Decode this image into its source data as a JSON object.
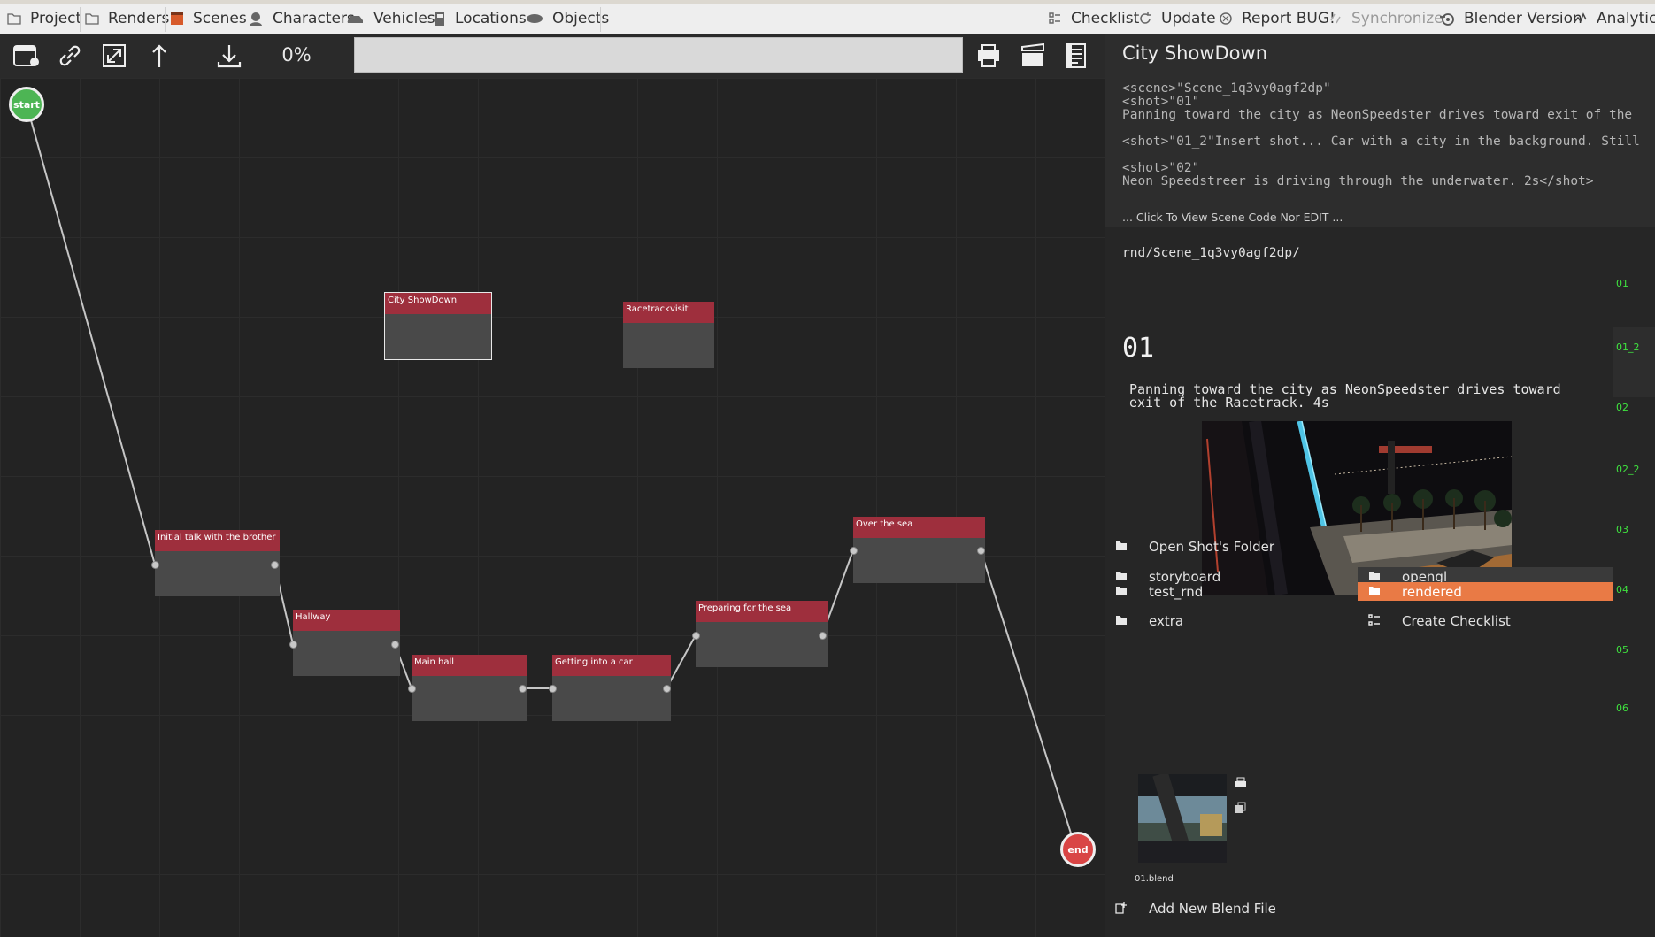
{
  "topbar": {
    "left_items": [
      {
        "label": "Project",
        "icon": "folder-icon"
      },
      {
        "label": "Renders",
        "icon": "folder-icon"
      },
      {
        "label": "Scenes",
        "icon": "clapper-icon"
      },
      {
        "label": "Characters",
        "icon": "character-icon"
      },
      {
        "label": "Vehicles",
        "icon": "vehicle-icon"
      },
      {
        "label": "Locations",
        "icon": "location-icon"
      },
      {
        "label": "Objects",
        "icon": "object-icon"
      }
    ],
    "right_items": [
      {
        "label": "Checklist",
        "icon": "checklist-icon"
      },
      {
        "label": "Update",
        "icon": "update-icon"
      },
      {
        "label": "Report BUG!",
        "icon": "bug-icon"
      },
      {
        "label": "Synchronize",
        "icon": "sync-icon"
      },
      {
        "label": "Blender Version",
        "icon": "blender-icon"
      },
      {
        "label": "Analytics",
        "icon": "analytics-icon"
      }
    ]
  },
  "toolbar": {
    "progress": "0%",
    "search_value": ""
  },
  "canvas": {
    "start_label": "start",
    "end_label": "end",
    "nodes": [
      {
        "title": "City ShowDown",
        "selected": true
      },
      {
        "title": "Racetrackvisit"
      },
      {
        "title": "Initial talk with the brother"
      },
      {
        "title": "Hallway"
      },
      {
        "title": "Main hall"
      },
      {
        "title": "Getting into a car"
      },
      {
        "title": "Preparing for the sea"
      },
      {
        "title": "Over the sea"
      }
    ]
  },
  "panel": {
    "title": "City ShowDown",
    "code_lines": "<scene>\"Scene_1q3vy0agf2dp\"\n<shot>\"01\"\nPanning toward the city as NeonSpeedster drives toward exit of the\n\n<shot>\"01_2\"Insert shot... Car with a city in the background. Still\n\n<shot>\"02\"\nNeon Speedstreer is driving through the underwater. 2s</shot>",
    "code_link": "... Click To View Scene Code Nor EDIT ...",
    "path": "rnd/Scene_1q3vy0agf2dp/",
    "shot_number": "01",
    "shot_description": "Panning toward the city as NeonSpeedster drives toward\nexit of the Racetrack. 4s",
    "open_folder": "Open Shot's Folder",
    "folders_left": [
      "storyboard",
      "test_rnd",
      "extra"
    ],
    "folders_right": [
      "opengl",
      "rendered"
    ],
    "selected_folder": "rendered",
    "create_checklist": "Create Checklist",
    "blend_file": "01.blend",
    "add_blend": "Add New Blend File",
    "shots": [
      "01",
      "01_2",
      "02",
      "02_2",
      "03",
      "04",
      "05",
      "06"
    ],
    "accent": "#e97a45",
    "shot_color": "#3fe23f"
  }
}
